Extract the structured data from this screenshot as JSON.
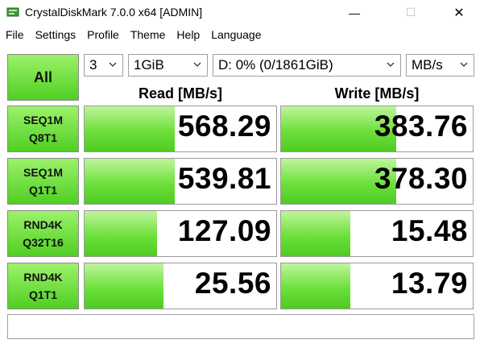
{
  "window": {
    "title": "CrystalDiskMark 7.0.0 x64 [ADMIN]",
    "minimize_glyph": "—",
    "maximize_glyph": "☐",
    "close_glyph": "✕"
  },
  "menu": [
    "File",
    "Settings",
    "Profile",
    "Theme",
    "Help",
    "Language"
  ],
  "controls": {
    "all_button": "All",
    "count": "3",
    "size": "1GiB",
    "drive": "D: 0% (0/1861GiB)",
    "unit": "MB/s"
  },
  "headers": {
    "read": "Read [MB/s]",
    "write": "Write [MB/s]"
  },
  "tests": [
    {
      "line1": "SEQ1M",
      "line2": "Q8T1",
      "read": "568.29",
      "write": "383.76",
      "read_fill": 0.47,
      "write_fill": 0.6
    },
    {
      "line1": "SEQ1M",
      "line2": "Q1T1",
      "read": "539.81",
      "write": "378.30",
      "read_fill": 0.47,
      "write_fill": 0.6
    },
    {
      "line1": "RND4K",
      "line2": "Q32T16",
      "read": "127.09",
      "write": "15.48",
      "read_fill": 0.38,
      "write_fill": 0.36
    },
    {
      "line1": "RND4K",
      "line2": "Q1T1",
      "read": "25.56",
      "write": "13.79",
      "read_fill": 0.41,
      "write_fill": 0.36
    }
  ],
  "status": ""
}
